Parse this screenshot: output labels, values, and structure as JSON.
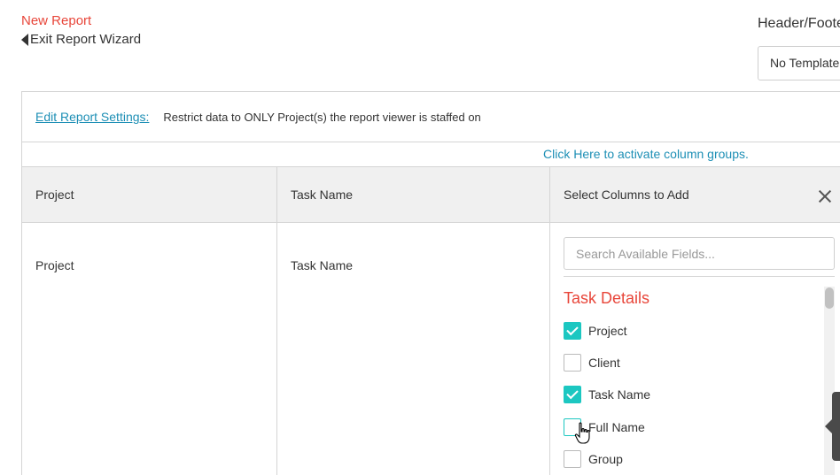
{
  "header": {
    "title": "New Report",
    "exit_label": "Exit Report Wizard",
    "header_footer_label": "Header/Footer",
    "template_value": "No Template"
  },
  "settings": {
    "edit_label": "Edit Report Settings:",
    "restrict_text": "Restrict data to ONLY Project(s) the report viewer is staffed on"
  },
  "column_groups_link": "Click Here to activate column groups.",
  "table": {
    "columns": [
      "Project",
      "Task Name",
      "Select Columns to Add"
    ],
    "row": [
      "Project",
      "Task Name"
    ]
  },
  "field_picker": {
    "search_placeholder": "Search Available Fields...",
    "section_title": "Task Details",
    "fields": [
      {
        "label": "Project",
        "checked": true
      },
      {
        "label": "Client",
        "checked": false
      },
      {
        "label": "Task Name",
        "checked": true
      },
      {
        "label": "Full Name",
        "checked": false
      },
      {
        "label": "Group",
        "checked": false
      }
    ]
  },
  "colors": {
    "accent_red": "#e8463a",
    "link_blue": "#1d8fb5",
    "check_teal": "#1cc7c1"
  }
}
